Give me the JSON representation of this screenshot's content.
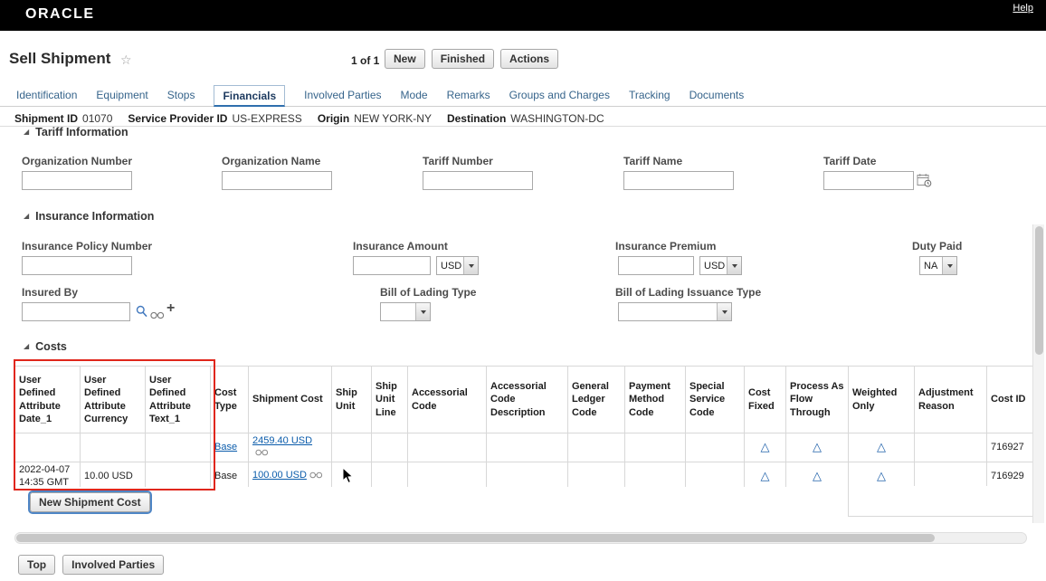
{
  "topbar": {
    "brand": "ORACLE",
    "help": "Help"
  },
  "page": {
    "title": "Sell Shipment"
  },
  "toolbar": {
    "record_indicator": "1 of 1",
    "new": "New",
    "finished": "Finished",
    "actions": "Actions"
  },
  "tabs": [
    "Identification",
    "Equipment",
    "Stops",
    "Financials",
    "Involved Parties",
    "Mode",
    "Remarks",
    "Groups and Charges",
    "Tracking",
    "Documents"
  ],
  "summary": [
    {
      "label": "Shipment ID",
      "value": "01070"
    },
    {
      "label": "Service Provider ID",
      "value": "US-EXPRESS"
    },
    {
      "label": "Origin",
      "value": "NEW YORK-NY"
    },
    {
      "label": "Destination",
      "value": "WASHINGTON-DC"
    }
  ],
  "tariff": {
    "title": "Tariff Information",
    "labels": [
      "Organization Number",
      "Organization Name",
      "Tariff Number",
      "Tariff Name",
      "Tariff Date"
    ]
  },
  "insurance": {
    "title": "Insurance Information",
    "policy_label": "Insurance Policy Number",
    "amount_label": "Insurance Amount",
    "amount_currency": "USD",
    "premium_label": "Insurance Premium",
    "premium_currency": "USD",
    "duty_label": "Duty Paid",
    "duty_value": "NA",
    "insured_by_label": "Insured By",
    "bol_type_label": "Bill of Lading Type",
    "bol_issuance_label": "Bill of Lading Issuance Type"
  },
  "costs": {
    "title": "Costs",
    "new_button": "New Shipment Cost",
    "columns": [
      "User Defined Attribute Date_1",
      "User Defined Attribute Currency",
      "User Defined Attribute Text_1",
      "Cost Type",
      "Shipment Cost",
      "Ship Unit",
      "Ship Unit Line",
      "Accessorial Code",
      "Accessorial Code Description",
      "General Ledger Code",
      "Payment Method Code",
      "Special Service Code",
      "Cost Fixed",
      "Process As Flow Through",
      "Weighted Only",
      "Adjustment Reason",
      "Cost ID"
    ],
    "rows": [
      {
        "uda_date": "",
        "uda_currency": "",
        "uda_text": "",
        "cost_type": "Base",
        "shipment_cost": "2459.40 USD",
        "ship_unit": "",
        "ship_unit_line": "",
        "accessorial_code": "",
        "accessorial_desc": "",
        "gl_code": "",
        "payment_method": "",
        "special_service": "",
        "adjustment_reason": "",
        "cost_id": "716927"
      },
      {
        "uda_date": "2022-04-07 14:35 GMT",
        "uda_currency": "10.00 USD",
        "uda_text": "",
        "cost_type": "Base",
        "shipment_cost": "100.00 USD",
        "ship_unit": "",
        "ship_unit_line": "",
        "accessorial_code": "",
        "accessorial_desc": "",
        "gl_code": "",
        "payment_method": "",
        "special_service": "",
        "adjustment_reason": "",
        "cost_id": "716929"
      }
    ]
  },
  "footer": {
    "top": "Top",
    "involved_parties": "Involved Parties"
  },
  "icons": {
    "star": "☆",
    "disclosure": "◢",
    "plus": "+",
    "flag": "△"
  }
}
